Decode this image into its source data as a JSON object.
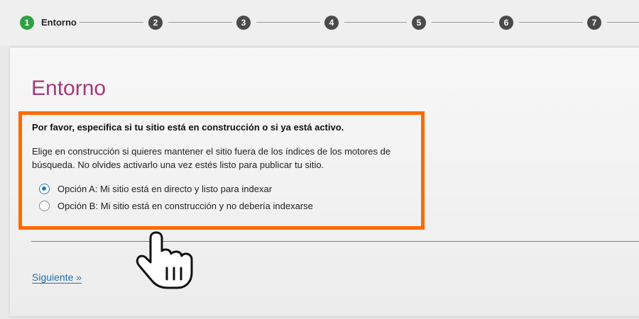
{
  "stepper": {
    "steps": [
      {
        "number": "1",
        "label": "Entorno",
        "active": true
      },
      {
        "number": "2"
      },
      {
        "number": "3"
      },
      {
        "number": "4"
      },
      {
        "number": "5"
      },
      {
        "number": "6"
      },
      {
        "number": "7"
      }
    ]
  },
  "page": {
    "title": "Entorno",
    "question": "Por favor, especifica si tu sitio está en construcción o si ya está activo.",
    "help_text": "Elige en construcción si quieres mantener el sitio fuera de los índices de los motores de búsqueda. No olvides activarlo una vez estés listo para publicar tu sitio.",
    "options": [
      {
        "label": "Opción A: Mi sitio está en directo y listo para indexar",
        "selected": true
      },
      {
        "label": "Opción B: Mi sitio está en construcción y no debería indexarse",
        "selected": false
      }
    ],
    "next_link": "Siguiente »"
  },
  "colors": {
    "title": "#a23a7a",
    "highlight": "#ff6a00",
    "active_step": "#2ea043",
    "link": "#2a6fa8",
    "radio_selected": "#2a7bb3"
  },
  "icons": {
    "cursor": "hand-pointer-icon"
  }
}
